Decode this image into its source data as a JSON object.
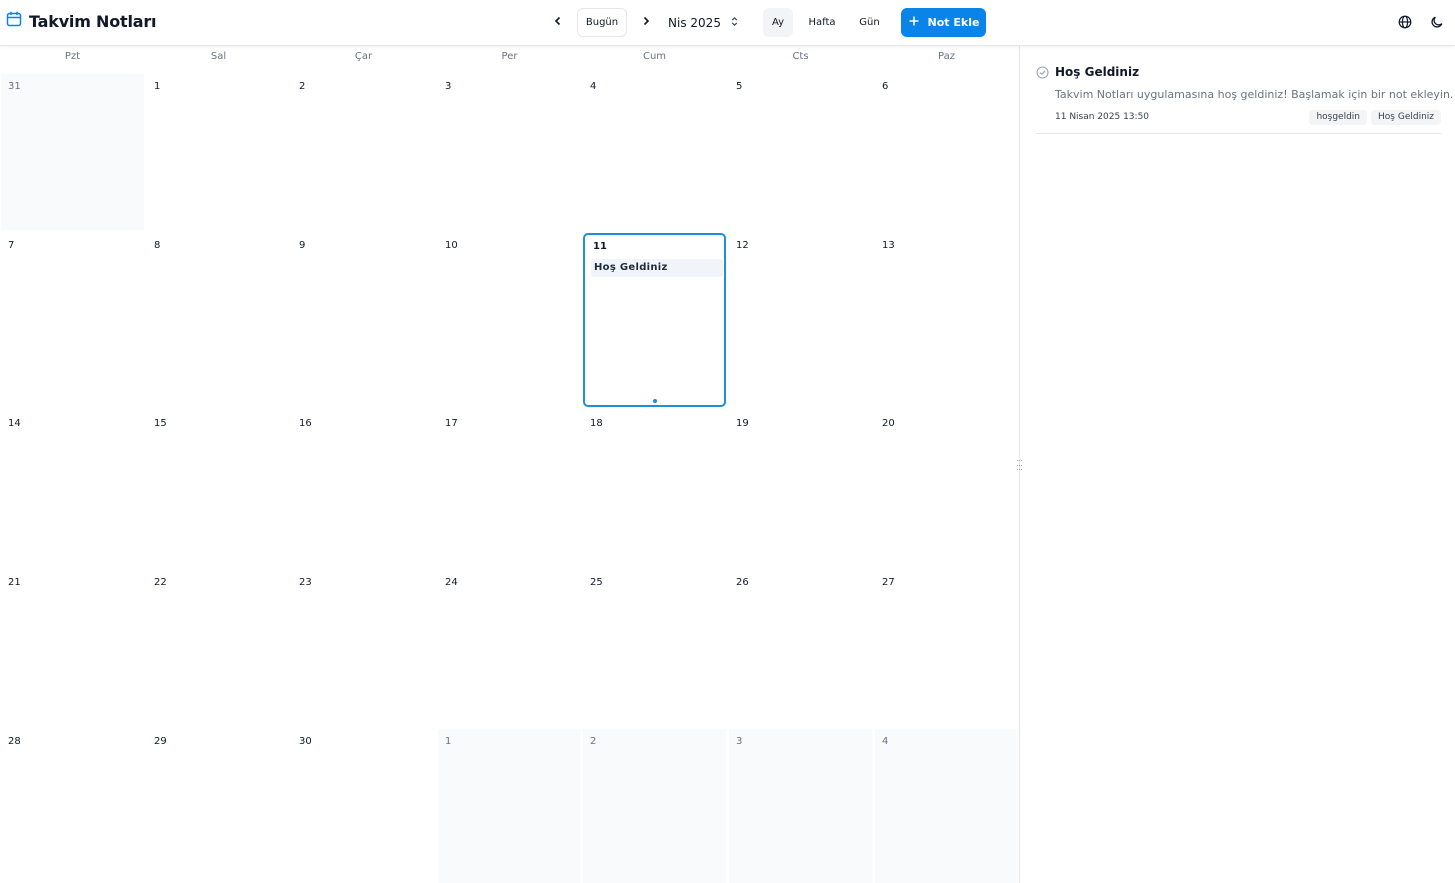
{
  "app": {
    "title": "Takvim Notları",
    "accent_color": "#0a84e8"
  },
  "header": {
    "prev_icon": "chevron-left-icon",
    "next_icon": "chevron-right-icon",
    "today_label": "Bugün",
    "current_month": "Nis 2025",
    "views": [
      {
        "label": "Ay",
        "active": true
      },
      {
        "label": "Hafta",
        "active": false
      },
      {
        "label": "Gün",
        "active": false
      }
    ],
    "add_note_label": "Not Ekle",
    "language_icon": "globe-icon",
    "theme_icon": "moon-icon"
  },
  "calendar": {
    "weekdays": [
      "Pzt",
      "Sal",
      "Çar",
      "Per",
      "Cum",
      "Cts",
      "Paz"
    ],
    "weeks": [
      [
        {
          "day": "31",
          "outside": true
        },
        {
          "day": "1"
        },
        {
          "day": "2"
        },
        {
          "day": "3"
        },
        {
          "day": "4"
        },
        {
          "day": "5"
        },
        {
          "day": "6"
        }
      ],
      [
        {
          "day": "7"
        },
        {
          "day": "8"
        },
        {
          "day": "9"
        },
        {
          "day": "10"
        },
        {
          "day": "11",
          "selected": true,
          "notes": [
            "Hoş Geldiniz"
          ]
        },
        {
          "day": "12"
        },
        {
          "day": "13"
        }
      ],
      [
        {
          "day": "14"
        },
        {
          "day": "15"
        },
        {
          "day": "16"
        },
        {
          "day": "17"
        },
        {
          "day": "18"
        },
        {
          "day": "19"
        },
        {
          "day": "20"
        }
      ],
      [
        {
          "day": "21"
        },
        {
          "day": "22"
        },
        {
          "day": "23"
        },
        {
          "day": "24"
        },
        {
          "day": "25"
        },
        {
          "day": "26"
        },
        {
          "day": "27"
        }
      ],
      [
        {
          "day": "28"
        },
        {
          "day": "29"
        },
        {
          "day": "30"
        },
        {
          "day": "1",
          "outside": true
        },
        {
          "day": "2",
          "outside": true
        },
        {
          "day": "3",
          "outside": true
        },
        {
          "day": "4",
          "outside": true
        }
      ]
    ]
  },
  "sidebar": {
    "notes": [
      {
        "title": "Hoş Geldiniz",
        "description": "Takvim Notları uygulamasına hoş geldiniz! Başlamak için bir not ekleyin.",
        "date": "11 Nisan 2025 13:50",
        "tags": [
          "hoşgeldin",
          "Hoş Geldiniz"
        ]
      }
    ]
  }
}
